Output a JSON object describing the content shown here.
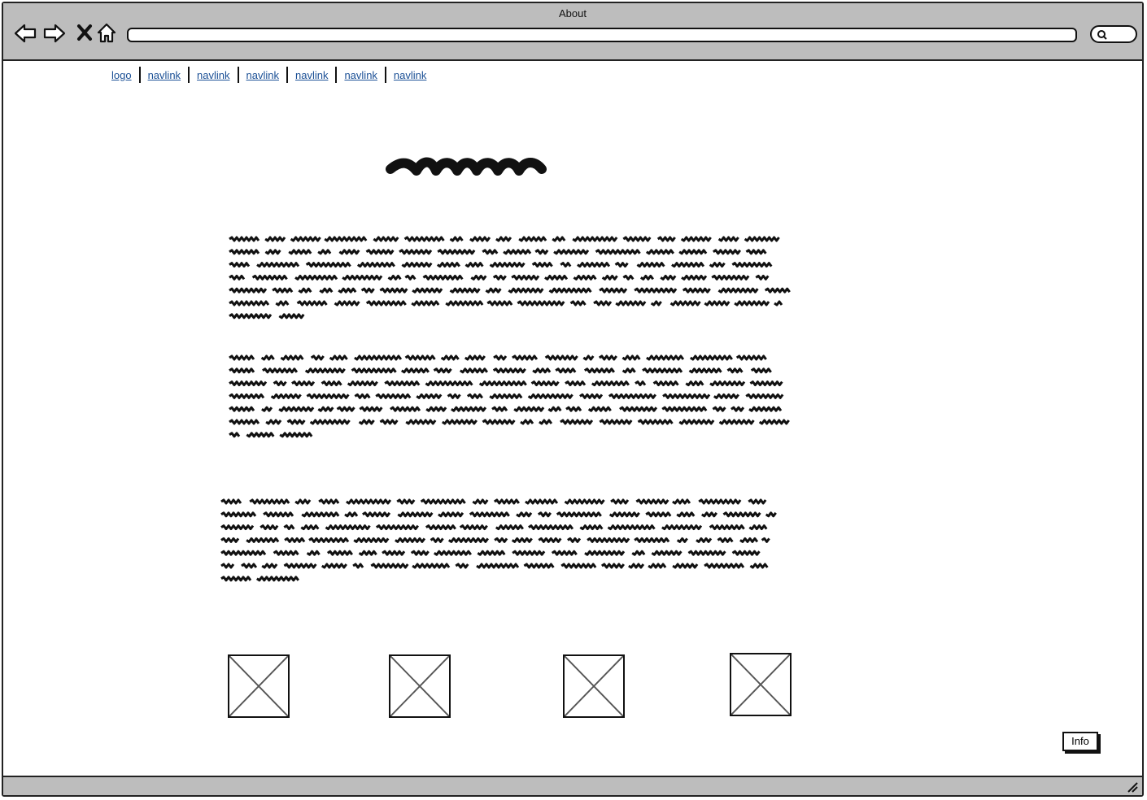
{
  "window": {
    "title": "About"
  },
  "nav": {
    "items": [
      {
        "label": "logo"
      },
      {
        "label": "navlink"
      },
      {
        "label": "navlink"
      },
      {
        "label": "navlink"
      },
      {
        "label": "navlink"
      },
      {
        "label": "navlink"
      },
      {
        "label": "navlink"
      }
    ]
  },
  "info_button": {
    "label": "Info"
  },
  "icons": {
    "back": "back-arrow-icon",
    "forward": "forward-arrow-icon",
    "stop": "close-icon",
    "home": "home-icon",
    "search": "search-icon",
    "resize": "resize-handle-icon",
    "image": "image-placeholder-icon"
  }
}
